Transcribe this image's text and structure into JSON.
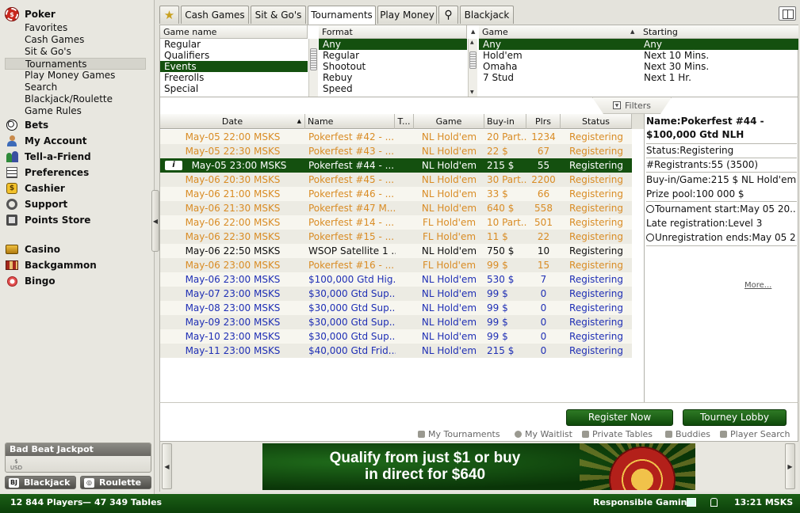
{
  "sidebar": {
    "poker": {
      "label": "Poker",
      "subitems": [
        "Favorites",
        "Cash Games",
        "Sit & Go's",
        "Tournaments",
        "Play Money Games",
        "Search",
        "Blackjack/Roulette",
        "Game Rules"
      ],
      "selected": "Tournaments"
    },
    "sections": [
      "Bets",
      "My Account",
      "Tell-a-Friend",
      "Preferences",
      "Cashier",
      "Support",
      "Points Store"
    ],
    "games": [
      "Casino",
      "Backgammon",
      "Bingo"
    ],
    "jackpot": {
      "title": "Bad Beat Jackpot",
      "currency": "USD"
    },
    "buttons": {
      "blackjack": "Blackjack",
      "roulette": "Roulette"
    }
  },
  "tabs": [
    {
      "label": "★",
      "name": "favorites"
    },
    {
      "label": "Cash Games",
      "name": "cash-games"
    },
    {
      "label": "Sit & Go's",
      "name": "sit-and-gos"
    },
    {
      "label": "Tournaments",
      "name": "tournaments",
      "active": true
    },
    {
      "label": "Play Money",
      "name": "play-money"
    },
    {
      "label": "⚲",
      "name": "search"
    },
    {
      "label": "Blackjack",
      "name": "blackjack"
    }
  ],
  "filters": {
    "game_name": {
      "header": "Game name",
      "options": [
        "Regular",
        "Qualifiers",
        "Events",
        "Freerolls",
        "Special"
      ],
      "selected": "Events"
    },
    "format": {
      "header": "Format",
      "options": [
        "Any",
        "Regular",
        "Shootout",
        "Rebuy",
        "Speed"
      ],
      "selected": "Any"
    },
    "game": {
      "header": "Game",
      "options": [
        "Any",
        "Hold'em",
        "Omaha",
        "7 Stud"
      ],
      "selected": "Any"
    },
    "starting": {
      "header": "Starting",
      "options": [
        "Any",
        "Next 10 Mins.",
        "Next 30 Mins.",
        "Next 1 Hr."
      ],
      "selected": "Any"
    },
    "toggle_label": "Filters"
  },
  "table": {
    "columns": [
      "Date",
      "Name",
      "T...",
      "Game",
      "Buy-in",
      "Plrs",
      "Status"
    ],
    "rows": [
      {
        "date": "May-05 22:00 MSKS",
        "name": "Pokerfest #42 - ...",
        "game": "NL Hold'em",
        "buyin": "20 Part...",
        "plrs": "1234",
        "status": "Registering",
        "color": "#d98c25"
      },
      {
        "date": "May-05 22:30 MSKS",
        "name": "Pokerfest #43 - ...",
        "game": "NL Hold'em",
        "buyin": "22 $",
        "plrs": "67",
        "status": "Registering",
        "color": "#d98c25"
      },
      {
        "date": "May-05 23:00 MSKS",
        "name": "Pokerfest #44 - ...",
        "game": "NL Hold'em",
        "buyin": "215 $",
        "plrs": "55",
        "status": "Registering",
        "color": "#ffffff",
        "selected": true
      },
      {
        "date": "May-06 20:30 MSKS",
        "name": "Pokerfest #45 - ...",
        "game": "NL Hold'em",
        "buyin": "30 Part...",
        "plrs": "2200",
        "status": "Registering",
        "color": "#d98c25"
      },
      {
        "date": "May-06 21:00 MSKS",
        "name": "Pokerfest #46 - ...",
        "game": "NL Hold'em",
        "buyin": "33 $",
        "plrs": "66",
        "status": "Registering",
        "color": "#d98c25"
      },
      {
        "date": "May-06 21:30 MSKS",
        "name": "Pokerfest #47 M...",
        "game": "NL Hold'em",
        "buyin": "640 $",
        "plrs": "558",
        "status": "Registering",
        "color": "#d98c25"
      },
      {
        "date": "May-06 22:00 MSKS",
        "name": "Pokerfest #14 - ...",
        "game": "FL Hold'em",
        "buyin": "10 Part...",
        "plrs": "501",
        "status": "Registering",
        "color": "#d98c25"
      },
      {
        "date": "May-06 22:30 MSKS",
        "name": "Pokerfest #15 - ...",
        "game": "FL Hold'em",
        "buyin": "11 $",
        "plrs": "22",
        "status": "Registering",
        "color": "#d98c25"
      },
      {
        "date": "May-06 22:50 MSKS",
        "name": "WSOP Satellite 1 ..",
        "game": "NL Hold'em",
        "buyin": "750 $",
        "plrs": "10",
        "status": "Registering",
        "color": "#111111"
      },
      {
        "date": "May-06 23:00 MSKS",
        "name": "Pokerfest #16 - ...",
        "game": "FL Hold'em",
        "buyin": "99 $",
        "plrs": "15",
        "status": "Registering",
        "color": "#d98c25"
      },
      {
        "date": "May-06 23:00 MSKS",
        "name": "$100,000 Gtd Hig...",
        "game": "NL Hold'em",
        "buyin": "530 $",
        "plrs": "7",
        "status": "Registering",
        "color": "#1f2fb5"
      },
      {
        "date": "May-07 23:00 MSKS",
        "name": "$30,000 Gtd Sup...",
        "game": "NL Hold'em",
        "buyin": "99 $",
        "plrs": "0",
        "status": "Registering",
        "color": "#1f2fb5"
      },
      {
        "date": "May-08 23:00 MSKS",
        "name": "$30,000 Gtd Sup...",
        "game": "NL Hold'em",
        "buyin": "99 $",
        "plrs": "0",
        "status": "Registering",
        "color": "#1f2fb5"
      },
      {
        "date": "May-09 23:00 MSKS",
        "name": "$30,000 Gtd Sup...",
        "game": "NL Hold'em",
        "buyin": "99 $",
        "plrs": "0",
        "status": "Registering",
        "color": "#1f2fb5"
      },
      {
        "date": "May-10 23:00 MSKS",
        "name": "$30,000 Gtd Sup...",
        "game": "NL Hold'em",
        "buyin": "99 $",
        "plrs": "0",
        "status": "Registering",
        "color": "#1f2fb5"
      },
      {
        "date": "May-11 23:00 MSKS",
        "name": "$40,000 Gtd Frid...",
        "game": "NL Hold'em",
        "buyin": "215 $",
        "plrs": "0",
        "status": "Registering",
        "color": "#1f2fb5"
      }
    ]
  },
  "details": {
    "title": "Name:Pokerfest #44 - $100,000 Gtd NLH",
    "status": "Status:Registering",
    "registrants": "#Registrants:55 (3500)",
    "buyin": "Buy-in/Game:215 $ NL Hold'em",
    "prize_pool": "Prize pool:100 000 $",
    "start": "Tournament start:May 05 20...",
    "late_reg": "Late registration:Level 3",
    "unreg": "Unregistration ends:May 05 2...",
    "more": "More..."
  },
  "actions": {
    "register": "Register Now",
    "lobby": "Tourney Lobby",
    "links": [
      "My Tournaments",
      "My Waitlist",
      "Private Tables",
      "Buddies",
      "Player Search"
    ]
  },
  "banner": {
    "line1": "Qualify from just $1 or buy",
    "line2": "in direct for $640"
  },
  "status_bar": {
    "players": "12 844 Players",
    "separator": "—",
    "tables": "47 349 Tables",
    "responsible": "Responsible Gaming",
    "time": "13:21 MSKS"
  },
  "colors": {
    "brand_green": "#14500f",
    "event_orange": "#d98c25",
    "guaranteed_blue": "#1f2fb5"
  }
}
